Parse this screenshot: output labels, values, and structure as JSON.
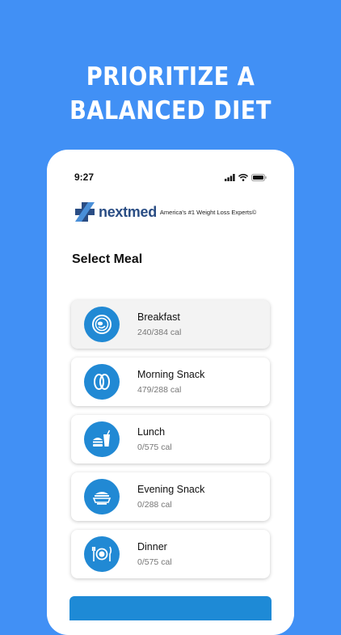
{
  "headline": {
    "line1": "PRIORITIZE A",
    "line2": "BALANCED DIET"
  },
  "status_bar": {
    "time": "9:27"
  },
  "brand": {
    "name": "nextmed",
    "tagline": "America's #1 Weight Loss Experts©"
  },
  "page_title": "Select Meal",
  "meals": [
    {
      "name": "Breakfast",
      "calories": "240/384 cal",
      "icon": "breakfast-plate-icon"
    },
    {
      "name": "Morning Snack",
      "calories": "479/288 cal",
      "icon": "snack-icon"
    },
    {
      "name": "Lunch",
      "calories": "0/575 cal",
      "icon": "lunch-burger-drink-icon"
    },
    {
      "name": "Evening Snack",
      "calories": "0/288 cal",
      "icon": "evening-snack-bowl-icon"
    },
    {
      "name": "Dinner",
      "calories": "0/575 cal",
      "icon": "dinner-plate-cutlery-icon"
    }
  ],
  "colors": {
    "background": "#4190f5",
    "accent": "#2189d4",
    "brand": "#2a4d84"
  }
}
